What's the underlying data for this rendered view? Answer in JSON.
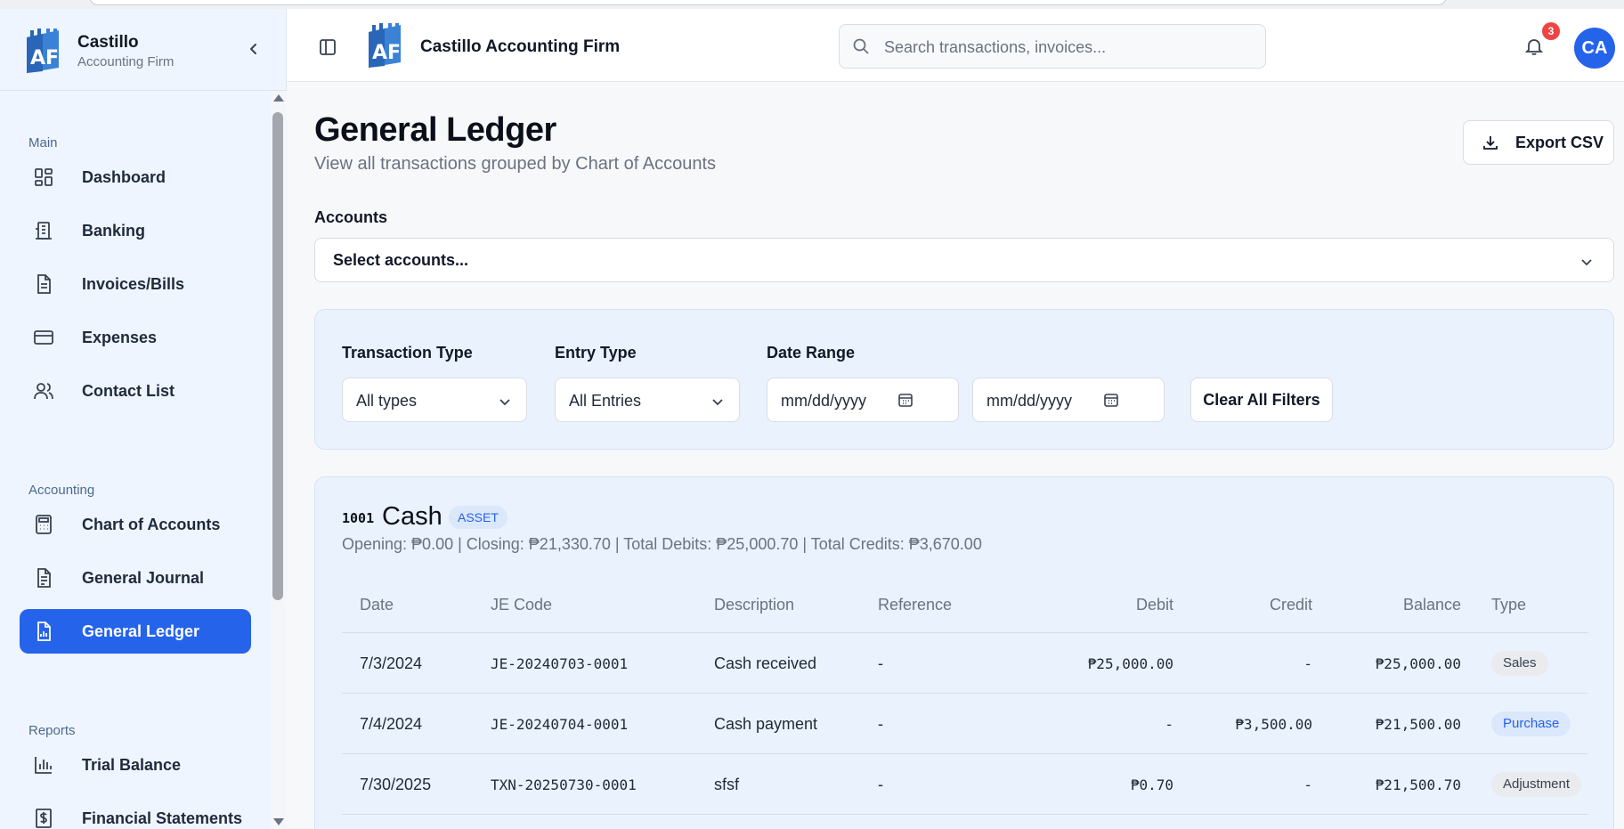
{
  "brand": {
    "name": "Castillo",
    "sub": "Accounting Firm",
    "collapse_icon": "chevron-left-icon"
  },
  "header": {
    "title": "Castillo Accounting Firm",
    "search_placeholder": "Search transactions, invoices...",
    "notification_count": "3",
    "avatar_initials": "CA"
  },
  "sidebar": {
    "sections": [
      {
        "title": "Main"
      },
      {
        "title": "Accounting"
      },
      {
        "title": "Reports"
      }
    ],
    "items": [
      {
        "label": "Dashboard",
        "icon": "dashboard-icon"
      },
      {
        "label": "Banking",
        "icon": "bank-icon"
      },
      {
        "label": "Invoices/Bills",
        "icon": "document-icon"
      },
      {
        "label": "Expenses",
        "icon": "credit-card-icon"
      },
      {
        "label": "Contact List",
        "icon": "users-icon"
      },
      {
        "label": "Chart of Accounts",
        "icon": "calculator-icon"
      },
      {
        "label": "General Journal",
        "icon": "journal-icon"
      },
      {
        "label": "General Ledger",
        "icon": "ledger-chart-icon",
        "active": true
      },
      {
        "label": "Trial Balance",
        "icon": "bar-chart-icon"
      },
      {
        "label": "Financial Statements",
        "icon": "dollar-file-icon"
      }
    ]
  },
  "page": {
    "title": "General Ledger",
    "subtitle": "View all transactions grouped by Chart of Accounts",
    "export_label": "Export CSV",
    "accounts_label": "Accounts",
    "accounts_placeholder": "Select accounts..."
  },
  "filters": {
    "transaction_type_label": "Transaction Type",
    "transaction_type_value": "All types",
    "entry_type_label": "Entry Type",
    "entry_type_value": "All Entries",
    "date_range_label": "Date Range",
    "date_from_placeholder": "mm/dd/yyyy",
    "date_to_placeholder": "mm/dd/yyyy",
    "clear_label": "Clear All Filters"
  },
  "account": {
    "code": "1001",
    "name": "Cash",
    "category": "ASSET",
    "summary": "Opening: ₱0.00 | Closing: ₱21,330.70 | Total Debits: ₱25,000.70 | Total Credits: ₱3,670.00",
    "columns": [
      "Date",
      "JE Code",
      "Description",
      "Reference",
      "Debit",
      "Credit",
      "Balance",
      "Type"
    ],
    "rows": [
      {
        "date": "7/3/2024",
        "je_code": "JE-20240703-0001",
        "description": "Cash received",
        "reference": "-",
        "debit": "₱25,000.00",
        "credit": "-",
        "balance": "₱25,000.00",
        "type": "Sales",
        "type_style": "gray"
      },
      {
        "date": "7/4/2024",
        "je_code": "JE-20240704-0001",
        "description": "Cash payment",
        "reference": "-",
        "debit": "-",
        "credit": "₱3,500.00",
        "balance": "₱21,500.00",
        "type": "Purchase",
        "type_style": "blue"
      },
      {
        "date": "7/30/2025",
        "je_code": "TXN-20250730-0001",
        "description": "sfsf",
        "reference": "-",
        "debit": "₱0.70",
        "credit": "-",
        "balance": "₱21,500.70",
        "type": "Adjustment",
        "type_style": "gray"
      }
    ]
  },
  "colors": {
    "primary": "#2563eb",
    "sidebar_bg": "#eff5fe",
    "panel_bg": "#eaf2fd",
    "badge_red": "#ef4444"
  }
}
